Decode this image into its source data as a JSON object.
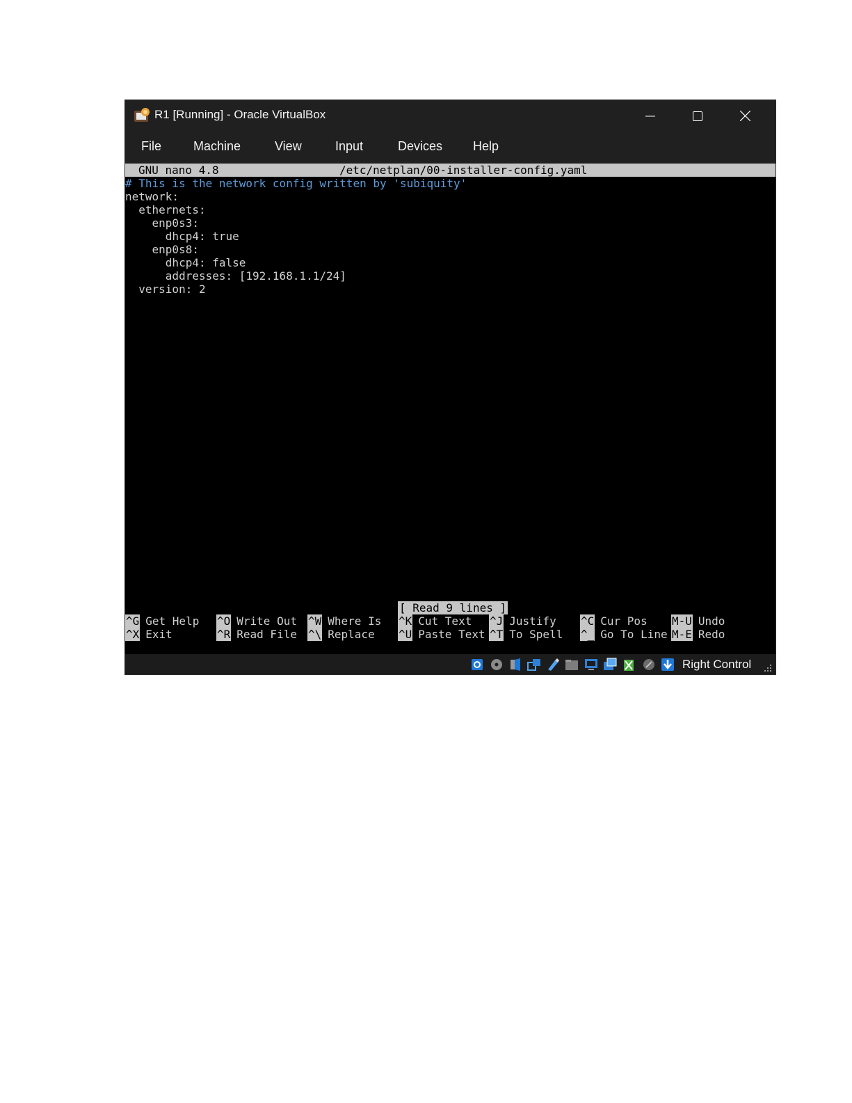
{
  "window": {
    "title": "R1 [Running] - Oracle VirtualBox"
  },
  "menu": {
    "items": [
      "File",
      "Machine",
      "View",
      "Input",
      "Devices",
      "Help"
    ]
  },
  "nano": {
    "version": "GNU nano 4.8",
    "filename": "/etc/netplan/00-installer-config.yaml",
    "lines": [
      "# This is the network config written by 'subiquity'",
      "network:",
      "  ethernets:",
      "    enp0s3:",
      "      dhcp4: true",
      "    enp0s8:",
      "      dhcp4: false",
      "      addresses: [192.168.1.1/24]",
      "  version: 2"
    ],
    "status_message": "[ Read 9 lines ]",
    "shortcuts": [
      {
        "key": "^G",
        "label": "Get Help"
      },
      {
        "key": "^O",
        "label": "Write Out"
      },
      {
        "key": "^W",
        "label": "Where Is"
      },
      {
        "key": "^K",
        "label": "Cut Text"
      },
      {
        "key": "^J",
        "label": "Justify"
      },
      {
        "key": "^C",
        "label": "Cur Pos"
      },
      {
        "key": "M-U",
        "label": "Undo"
      },
      {
        "key": "^X",
        "label": "Exit"
      },
      {
        "key": "^R",
        "label": "Read File"
      },
      {
        "key": "^\\",
        "label": "Replace"
      },
      {
        "key": "^U",
        "label": "Paste Text"
      },
      {
        "key": "^T",
        "label": "To Spell"
      },
      {
        "key": "^_",
        "label": "Go To Line"
      },
      {
        "key": "M-E",
        "label": "Redo"
      }
    ]
  },
  "statusbar": {
    "host_key": "Right Control",
    "icons": [
      "hard-disk-icon",
      "optical-drive-icon",
      "audio-icon",
      "network-icon",
      "usb-icon",
      "shared-folders-icon",
      "display-icon",
      "video-capture-icon",
      "recording-icon",
      "mouse-integration-icon",
      "keyboard-capture-icon"
    ]
  },
  "colors": {
    "titlebar": "#202020",
    "terminal_bg": "#000000",
    "terminal_fg": "#d0d0d0",
    "comment": "#5e9bd8",
    "nano_bar": "#c6c6c6"
  }
}
